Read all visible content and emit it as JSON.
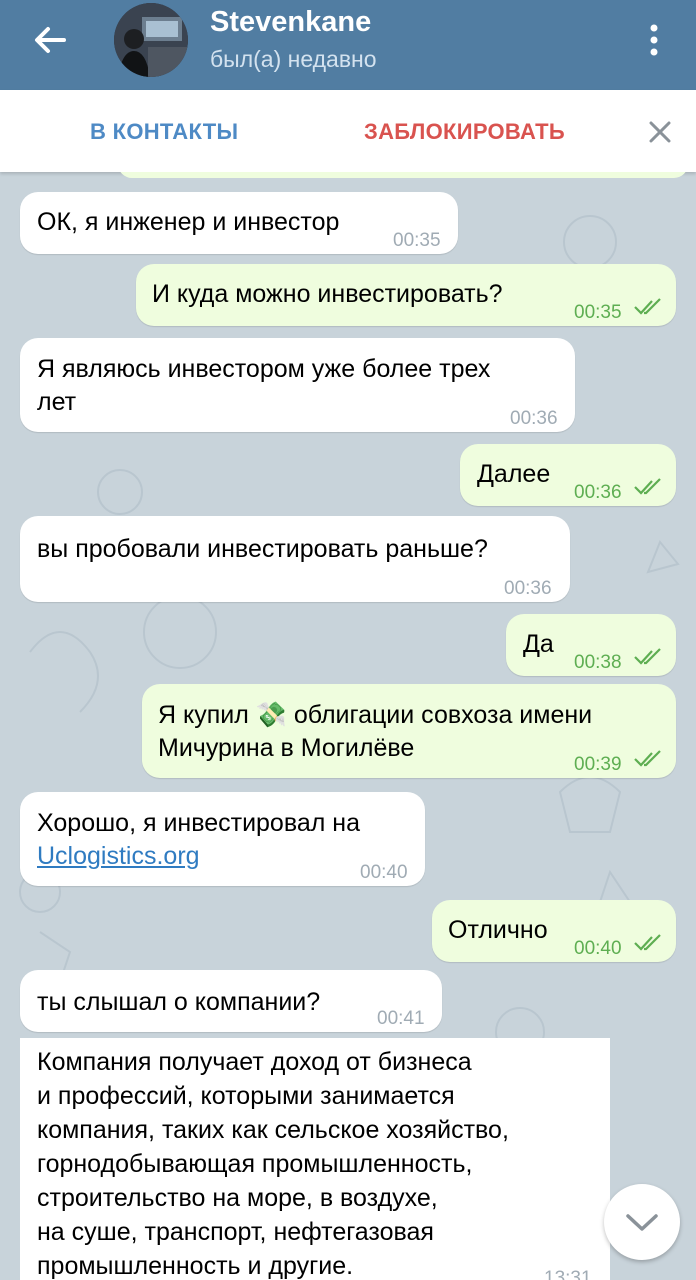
{
  "header": {
    "title": "Stevenkane",
    "status": "был(а) недавно"
  },
  "actionbar": {
    "add_contact": "В КОНТАКТЫ",
    "block": "ЗАБЛОКИРОВАТЬ"
  },
  "messages": [
    {
      "dir": "in",
      "text": "ОК, я инженер и инвестор",
      "time": "00:35"
    },
    {
      "dir": "out",
      "text": "И куда можно инвестировать?",
      "time": "00:35"
    },
    {
      "dir": "in",
      "text": "Я являюсь инвестором уже более трех лет",
      "line1": "Я являюсь инвестором уже более трех",
      "line2": "лет",
      "time": "00:36"
    },
    {
      "dir": "out",
      "text": "Далее",
      "time": "00:36"
    },
    {
      "dir": "in",
      "text": "вы пробовали инвестировать раньше?",
      "time": "00:36"
    },
    {
      "dir": "out",
      "text": "Да",
      "time": "00:38"
    },
    {
      "dir": "out",
      "line1_pre": "Я купил",
      "emoji": "💸",
      "line1_post": "облигации совхоза имени",
      "line2": "Мичурина в Могилёве",
      "time": "00:39"
    },
    {
      "dir": "in",
      "line1": "Хорошо, я инвестировал на",
      "link": "Uclogistics.org",
      "time": "00:40"
    },
    {
      "dir": "out",
      "text": "Отлично",
      "time": "00:40"
    },
    {
      "dir": "in",
      "text": "ты слышал о компании?",
      "time": "00:41"
    },
    {
      "dir": "in",
      "lines": [
        "Компания получает доход от бизнеса",
        "и профессий, которыми занимается",
        "компания, таких как сельское хозяйство,",
        "горнодобывающая промышленность,",
        "строительство на море, в воздухе,",
        "на суше, транспорт, нефтегазовая",
        "промышленность и другие."
      ],
      "time": "13:31"
    }
  ],
  "colors": {
    "header_bg": "#517da2",
    "chat_bg": "#c8d3da",
    "out_bubble": "#effdde",
    "in_bubble": "#ffffff",
    "link": "#2f7bc1",
    "block_red": "#d9534f",
    "contact_blue": "#4e8ac5"
  },
  "icons": [
    "back-arrow-icon",
    "more-vertical-icon",
    "close-icon",
    "double-check-icon",
    "chevron-down-icon"
  ]
}
